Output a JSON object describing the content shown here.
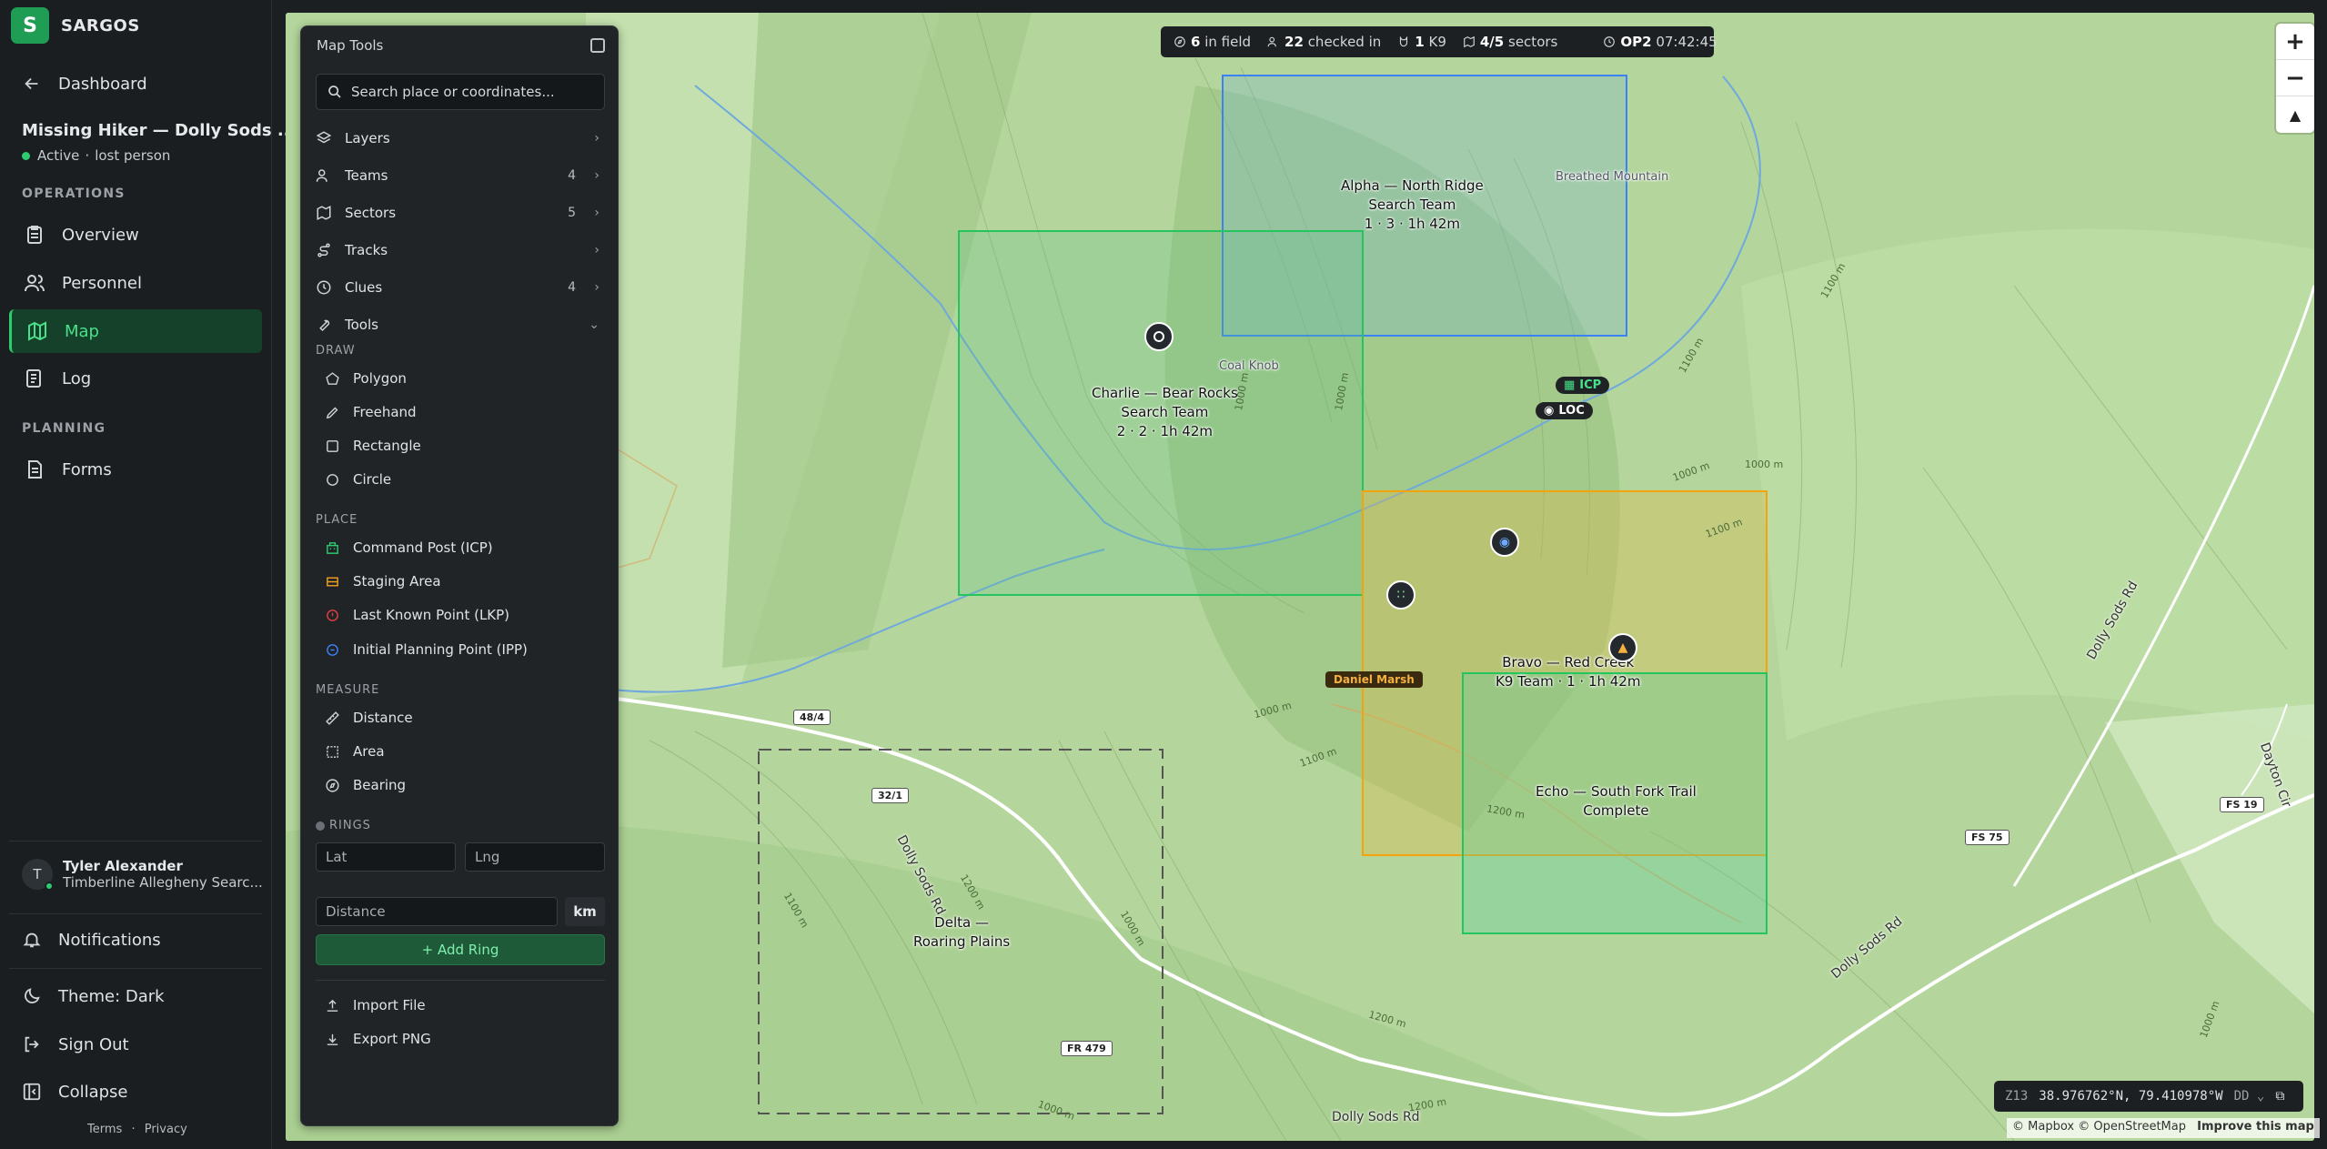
{
  "app": {
    "name": "SARGOS",
    "logo_letter": "S"
  },
  "sidebar": {
    "back_label": "Dashboard",
    "incident_title": "Missing Hiker — Dolly Sods ...",
    "incident_status": "Active",
    "incident_type": "lost person",
    "operations_header": "OPERATIONS",
    "nav": [
      {
        "label": "Overview",
        "icon": "clipboard-icon"
      },
      {
        "label": "Personnel",
        "icon": "users-icon"
      },
      {
        "label": "Map",
        "icon": "map-icon",
        "active": true
      },
      {
        "label": "Log",
        "icon": "log-icon"
      }
    ],
    "planning_header": "PLANNING",
    "forms_label": "Forms",
    "user": {
      "initial": "T",
      "name": "Tyler Alexander",
      "org": "Timberline Allegheny Searc..."
    },
    "notifications": "Notifications",
    "theme": "Theme: Dark",
    "signout": "Sign Out",
    "collapse": "Collapse",
    "terms": "Terms",
    "privacy": "Privacy"
  },
  "panel": {
    "title": "Map Tools",
    "search_placeholder": "Search place or coordinates...",
    "rows": [
      {
        "label": "Layers",
        "count": ""
      },
      {
        "label": "Teams",
        "count": "4"
      },
      {
        "label": "Sectors",
        "count": "5"
      },
      {
        "label": "Tracks",
        "count": ""
      },
      {
        "label": "Clues",
        "count": "4"
      },
      {
        "label": "Tools",
        "count": ""
      }
    ],
    "draw_header": "DRAW",
    "draw": [
      "Polygon",
      "Freehand",
      "Rectangle",
      "Circle"
    ],
    "place_header": "PLACE",
    "place": [
      {
        "label": "Command Post (ICP)",
        "color": "#2ecc71"
      },
      {
        "label": "Staging Area",
        "color": "#f0a020"
      },
      {
        "label": "Last Known Point (LKP)",
        "color": "#e04040"
      },
      {
        "label": "Initial Planning Point (IPP)",
        "color": "#3b82f6"
      }
    ],
    "measure_header": "MEASURE",
    "measure": [
      "Distance",
      "Area",
      "Bearing"
    ],
    "rings_header": "RINGS",
    "lat_placeholder": "Lat",
    "lng_placeholder": "Lng",
    "distance_placeholder": "Distance",
    "unit": "km",
    "add_ring": "+ Add Ring",
    "import": "Import File",
    "export": "Export PNG"
  },
  "stats": {
    "in_field": "6",
    "in_field_label": "in field",
    "checked_in": "22",
    "checked_in_label": "checked in",
    "k9": "1",
    "k9_label": "K9",
    "sectors": "4/5",
    "sectors_label": "sectors",
    "op": "OP2",
    "clock": "07:42:45"
  },
  "map": {
    "sectors": [
      {
        "name": "Alpha — North Ridge",
        "line2": "Search Team",
        "line3": "1 · 3 · 1h 42m",
        "color": "#3b82f6"
      },
      {
        "name": "Charlie — Bear Rocks",
        "line2": "Search Team",
        "line3": "2 · 2 · 1h 42m",
        "color": "#22c55e"
      },
      {
        "name": "Bravo — Red Creek",
        "line2": "K9 Team · 1 · 1h 42m",
        "line3": "",
        "color": "#f59e0b"
      },
      {
        "name": "Echo — South Fork Trail",
        "line2": "Complete",
        "line3": "",
        "color": "#22c55e"
      },
      {
        "name": "Delta —",
        "line2": "Roaring Plains",
        "line3": "",
        "color": "#555555"
      }
    ],
    "places": {
      "breathed": "Breathed Mountain",
      "coal": "Coal Knob"
    },
    "icp": "ICP",
    "loc": "LOC",
    "person": "Daniel Marsh",
    "shields": [
      "48/4",
      "32/1",
      "FR 479",
      "FS 75",
      "FS 19"
    ],
    "roads": [
      "Dolly Sods Rd",
      "Dolly Sods Rd",
      "Dolly Sods Rd",
      "Dolly Sods Rd",
      "Dayton Cir"
    ],
    "contours": [
      "1100 m",
      "1100 m",
      "1000 m",
      "1000 m",
      "1000 m",
      "1100 m",
      "1000 m",
      "1100 m",
      "1200 m",
      "1200 m",
      "1000 m",
      "1100 m",
      "1200 m",
      "1000 m",
      "1200 m",
      "1000 m",
      "1000 m"
    ]
  },
  "coords": {
    "zoom": "Z13",
    "lat": "38.976762°N, 79.410978°W",
    "format": "DD"
  },
  "attribution": {
    "text": "© Mapbox © OpenStreetMap",
    "improve": "Improve this map"
  }
}
